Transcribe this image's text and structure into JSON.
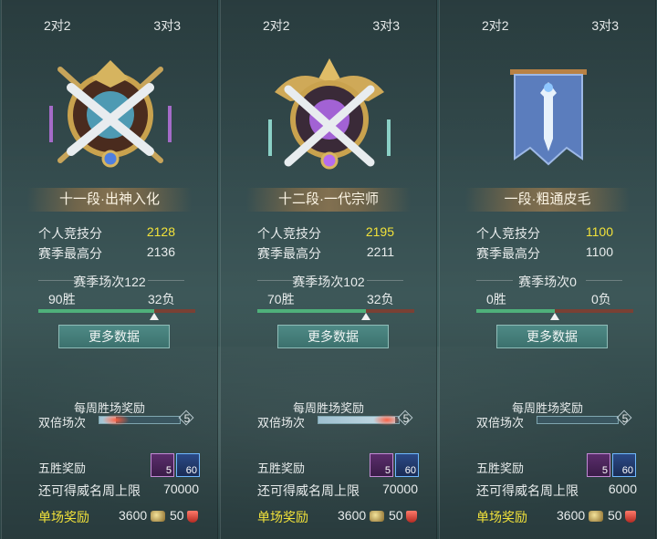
{
  "colors": {
    "gold_text": "#f2e23a",
    "win_bar": "#4fb07a",
    "loss_bar": "#7a4034",
    "button": "#3c716e"
  },
  "panels": [
    {
      "tabs": [
        "2对2",
        "3对3"
      ],
      "rank": "十一段·出神入化",
      "emblem": "gold-crossed-swords-emblem",
      "stats": [
        {
          "label": "个人竞技分",
          "value": "2128",
          "highlight": true
        },
        {
          "label": "赛季最高分",
          "value": "2136",
          "highlight": false
        }
      ],
      "season_title": "赛季场次122",
      "wins": "90胜",
      "losses": "32负",
      "win_fraction": 0.74,
      "more_button": "更多数据",
      "weekly_title": "每周胜场奖励",
      "double_label": "双倍场次",
      "double_value": "5",
      "double_fraction": 0.2,
      "five_win_label": "五胜奖励",
      "five_win_items": [
        {
          "icon": "treasure-chest-icon",
          "count": "5"
        },
        {
          "icon": "blue-scroll-icon",
          "count": "60"
        }
      ],
      "limit_label": "还可得威名周上限",
      "limit_value": "70000",
      "single_label": "单场奖励",
      "single_coin": "3600",
      "single_shield": "50"
    },
    {
      "tabs": [
        "2对2",
        "3对3"
      ],
      "rank": "十二段·一代宗师",
      "emblem": "gold-winged-sword-emblem",
      "stats": [
        {
          "label": "个人竞技分",
          "value": "2195",
          "highlight": true
        },
        {
          "label": "赛季最高分",
          "value": "2211",
          "highlight": false
        }
      ],
      "season_title": "赛季场次102",
      "wins": "70胜",
      "losses": "32负",
      "win_fraction": 0.69,
      "more_button": "更多数据",
      "weekly_title": "每周胜场奖励",
      "double_label": "双倍场次",
      "double_value": "5",
      "double_fraction": 0.95,
      "five_win_label": "五胜奖励",
      "five_win_items": [
        {
          "icon": "treasure-chest-icon",
          "count": "5"
        },
        {
          "icon": "blue-scroll-icon",
          "count": "60"
        }
      ],
      "limit_label": "还可得威名周上限",
      "limit_value": "70000",
      "single_label": "单场奖励",
      "single_coin": "3600",
      "single_shield": "50"
    },
    {
      "tabs": [
        "2对2",
        "3对3"
      ],
      "rank": "一段·粗通皮毛",
      "emblem": "blue-banner-sword-emblem",
      "stats": [
        {
          "label": "个人竞技分",
          "value": "1100",
          "highlight": true
        },
        {
          "label": "赛季最高分",
          "value": "1100",
          "highlight": false
        }
      ],
      "season_title": "赛季场次0",
      "wins": "0胜",
      "losses": "0负",
      "win_fraction": 0.5,
      "more_button": "更多数据",
      "weekly_title": "每周胜场奖励",
      "double_label": "双倍场次",
      "double_value": "5",
      "double_fraction": 0.0,
      "five_win_label": "五胜奖励",
      "five_win_items": [
        {
          "icon": "treasure-chest-icon",
          "count": "5"
        },
        {
          "icon": "blue-scroll-icon",
          "count": "60"
        }
      ],
      "limit_label": "还可得威名周上限",
      "limit_value": "6000",
      "single_label": "单场奖励",
      "single_coin": "3600",
      "single_shield": "50"
    }
  ]
}
